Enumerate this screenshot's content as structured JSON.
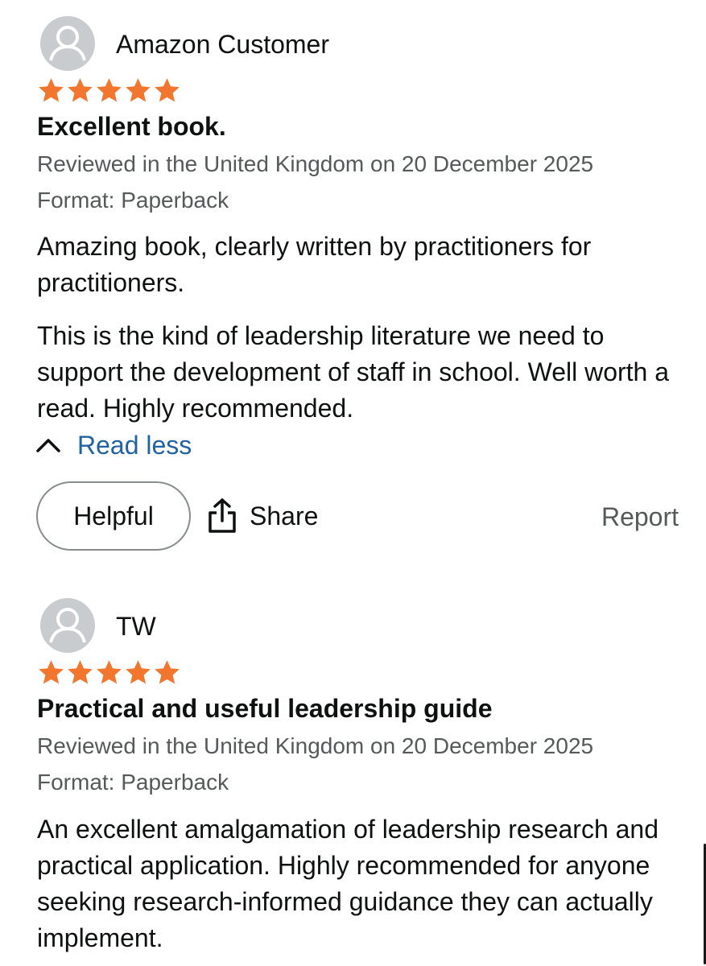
{
  "colors": {
    "star": "#f3762e",
    "link": "#2162a1",
    "meta_text": "#565959",
    "avatar_bg": "#c9ccce"
  },
  "reviews": [
    {
      "author": "Amazon Customer",
      "avatar_icon": "user-silhouette-icon",
      "rating": 5,
      "title": "Excellent book.",
      "date_line": "Reviewed in the United Kingdom on 20 December 2025",
      "format_line": "Format: Paperback",
      "paragraphs": [
        "Amazing book, clearly written by practitioners for practitioners.",
        "This is the kind of leadership literature we need to support the development of staff in school. Well worth a read. Highly recommended."
      ],
      "read_less_label": "Read less",
      "helpful_label": "Helpful",
      "share_label": "Share",
      "report_label": "Report"
    },
    {
      "author": "TW",
      "avatar_icon": "user-silhouette-icon",
      "rating": 5,
      "title": "Practical and useful leadership guide",
      "date_line": "Reviewed in the United Kingdom on 20 December 2025",
      "format_line": "Format: Paperback",
      "paragraphs": [
        "An excellent amalgamation of leadership research and practical application. Highly recommended for anyone seeking research-informed guidance they can actually implement."
      ]
    }
  ]
}
